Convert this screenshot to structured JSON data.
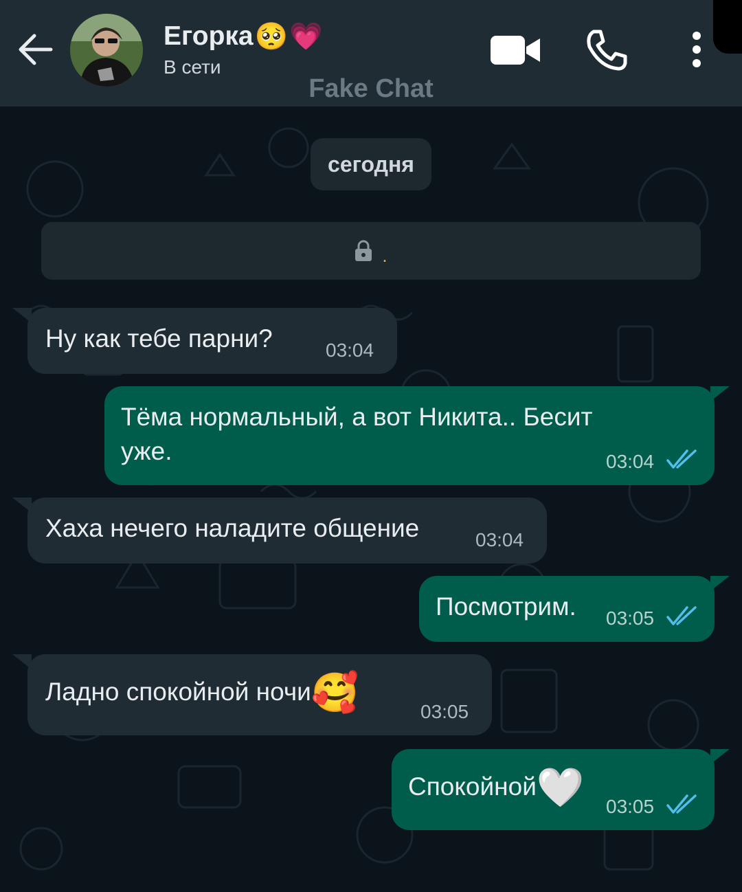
{
  "header": {
    "contact_name": "Егорка",
    "name_emojis": [
      "🥺",
      "💗"
    ],
    "status": "В сети",
    "watermark": "Fake Chat",
    "icons": [
      "back-arrow-icon",
      "video-call-icon",
      "phone-call-icon",
      "more-options-icon"
    ]
  },
  "chat": {
    "date_label": "сегодня",
    "encryption_notice": ".",
    "messages": [
      {
        "direction": "in",
        "text": "Ну как тебе парни?",
        "time": "03:04"
      },
      {
        "direction": "out",
        "text_line1": "Тёма нормальный, а вот Никита.. Бесит",
        "text_line2": "уже.",
        "time": "03:04",
        "status": "read"
      },
      {
        "direction": "in",
        "text": "Хаха нечего наладите общение",
        "time": "03:04"
      },
      {
        "direction": "out",
        "text": "Посмотрим.",
        "time": "03:05",
        "status": "read"
      },
      {
        "direction": "in",
        "text": "Ладно спокойной ночи",
        "emoji": "🥰",
        "time": "03:05"
      },
      {
        "direction": "out",
        "text": "Спокойной",
        "emoji": "🤍",
        "time": "03:05",
        "status": "read"
      }
    ]
  },
  "colors": {
    "header_bg": "#1f2c34",
    "chat_bg": "#0b141a",
    "incoming_bubble": "#202c33",
    "outgoing_bubble": "#005c4b",
    "read_ticks": "#53bdeb"
  }
}
